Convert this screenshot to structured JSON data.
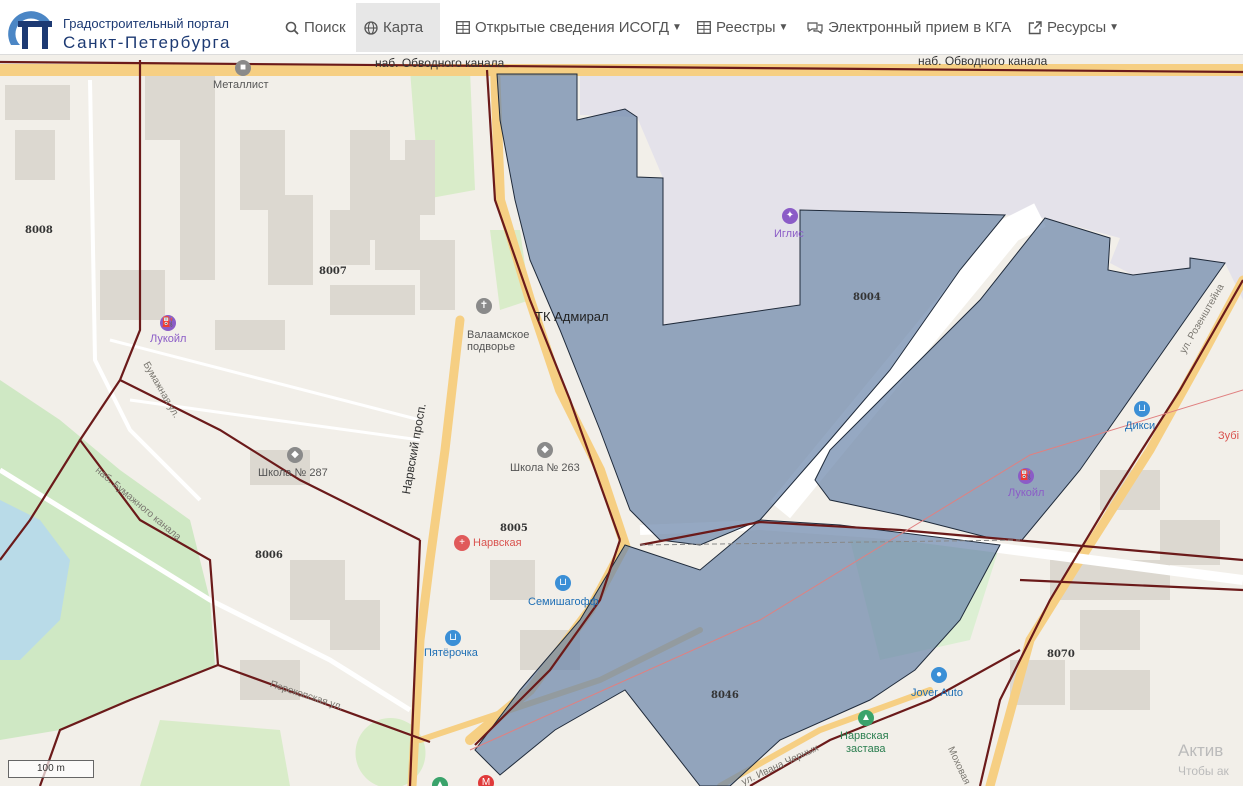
{
  "header": {
    "logo_line1": "Градостроительный портал",
    "logo_line2": "Санкт-Петербурга",
    "nav": [
      {
        "label": "Поиск",
        "icon": "search-icon"
      },
      {
        "label": "Карта",
        "icon": "globe-icon"
      },
      {
        "label": "Открытые сведения ИСОГД",
        "icon": "table-icon"
      },
      {
        "label": "Реестры",
        "icon": "table-icon"
      },
      {
        "label": "Электронный прием в КГА",
        "icon": "comments-icon"
      },
      {
        "label": "Ресурсы",
        "icon": "external-link-icon"
      }
    ]
  },
  "map": {
    "colors": {
      "highlight": "#6c86aa",
      "boundary": "#6b1a1a",
      "road": "#f6cf83"
    },
    "scale_label": "100 m",
    "streets": {
      "obvodny_left": "наб. Обводного канала",
      "obvodny_right": "наб. Обводного канала",
      "narvsky": "Нарвский просп.",
      "bumazhny": "наб. Бумажного канала",
      "perekopskaya": "Перекопская ул.",
      "ivana_chernykh": "ул. Ивана Черных",
      "rozenshteyna": "ул. Розенштейна",
      "mokhovaya": "Моховая",
      "bumazhnaya": "Бумажная ул."
    },
    "districts": [
      "8008",
      "8007",
      "8004",
      "8005",
      "8006",
      "8046",
      "8070"
    ],
    "poi": {
      "metallist": "Металлист",
      "lukoil1": "Лукойл",
      "admiral": "ТК Адмирал",
      "valaam": "Валаамское подворье",
      "school287": "Школа № 287",
      "school263": "Школа № 263",
      "narvskaya": "Нарвская",
      "semishagoff": "Семишагофф",
      "pyaterochka": "Пятёрочка",
      "iglis": "Иглис",
      "dixy": "Дикси",
      "zubi": "Зубі",
      "lukoil2": "Лукойл",
      "jover": "Jover Auto",
      "narvskaya_zastava_1": "Нарвская",
      "narvskaya_zastava_2": "застава"
    },
    "watermark_1": "Актив",
    "watermark_2": "Чтобы ак"
  }
}
